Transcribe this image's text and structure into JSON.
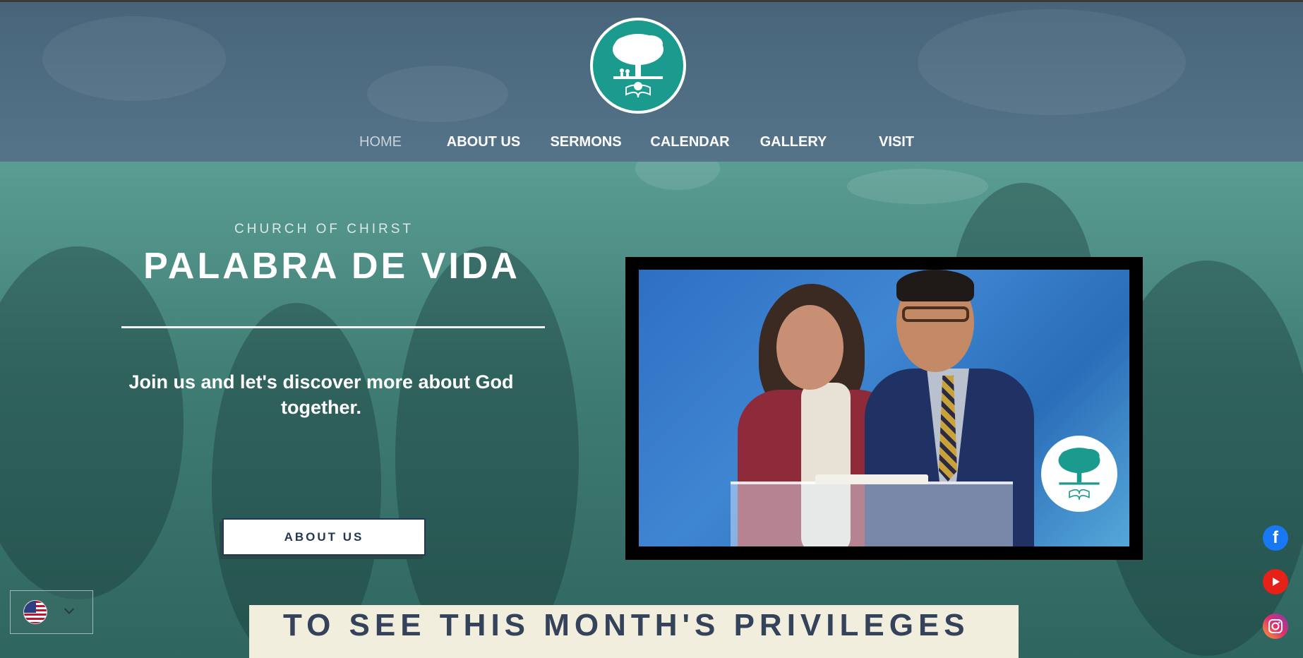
{
  "nav": {
    "items": [
      {
        "label": "HOME",
        "active": true
      },
      {
        "label": "ABOUT US",
        "active": false
      },
      {
        "label": "SERMONS",
        "active": false
      },
      {
        "label": "CALENDAR",
        "active": false
      },
      {
        "label": "GALLERY",
        "active": false
      },
      {
        "label": "VISIT",
        "active": false
      }
    ]
  },
  "hero": {
    "kicker": "CHURCH OF CHIRST",
    "title": "PALABRA DE VIDA",
    "tagline": "Join us and let's discover more about God together.",
    "button_label": "ABOUT US"
  },
  "banner": {
    "text": "TO SEE THIS MONTH'S PRIVILEGES"
  },
  "language": {
    "current": "English",
    "flag_icon": "us-flag-icon"
  },
  "social": {
    "facebook_glyph": "f",
    "icons": [
      "facebook-icon",
      "youtube-icon",
      "instagram-icon"
    ]
  },
  "colors": {
    "header_bg": "#4f6e84",
    "hero_tint": "#4a8f86",
    "logo_teal": "#1a9b8d",
    "navy_text": "#243853",
    "banner_bg": "#f1eedd"
  }
}
